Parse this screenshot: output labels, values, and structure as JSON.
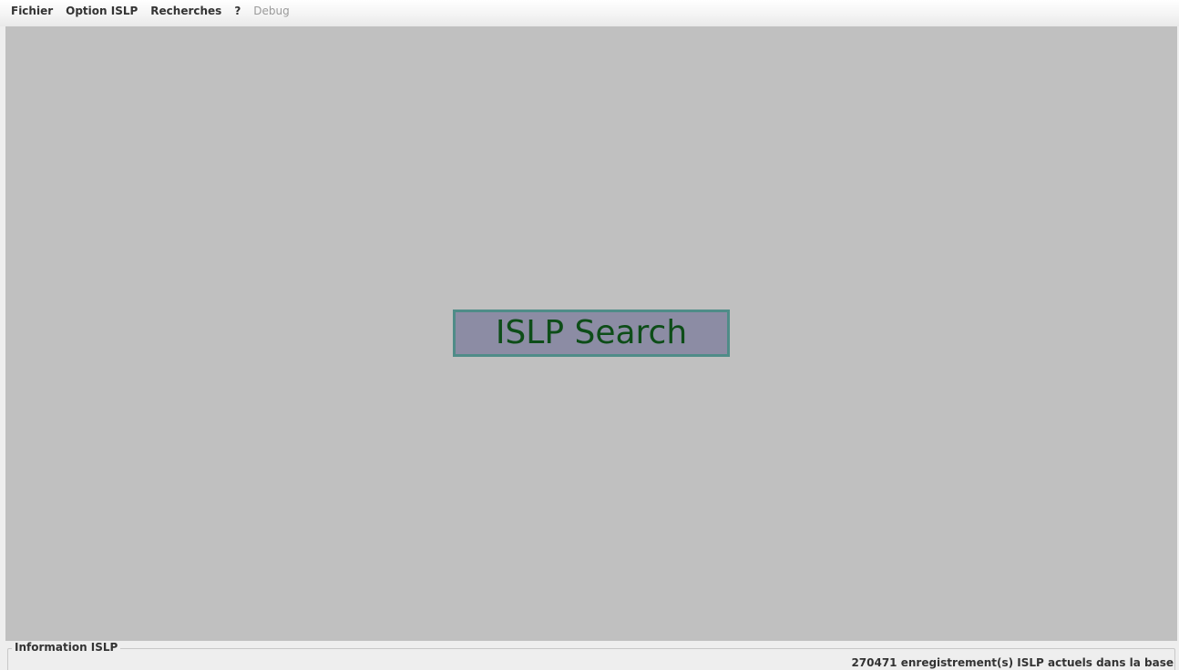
{
  "menubar": {
    "items": [
      {
        "label": "Fichier",
        "enabled": true
      },
      {
        "label": "Option ISLP",
        "enabled": true
      },
      {
        "label": "Recherches",
        "enabled": true
      },
      {
        "label": "?",
        "enabled": true
      },
      {
        "label": "Debug",
        "enabled": false
      }
    ]
  },
  "main": {
    "search_button_label": "ISLP Search"
  },
  "info_panel": {
    "title": "Information ISLP",
    "status": "270471 enregistrement(s) ISLP actuels dans la base"
  },
  "colors": {
    "desktop_background": "#c0c0c0",
    "search_box_fill": "#8c8ca4",
    "search_box_border": "#4f8c88",
    "search_text": "#0d4d18"
  }
}
